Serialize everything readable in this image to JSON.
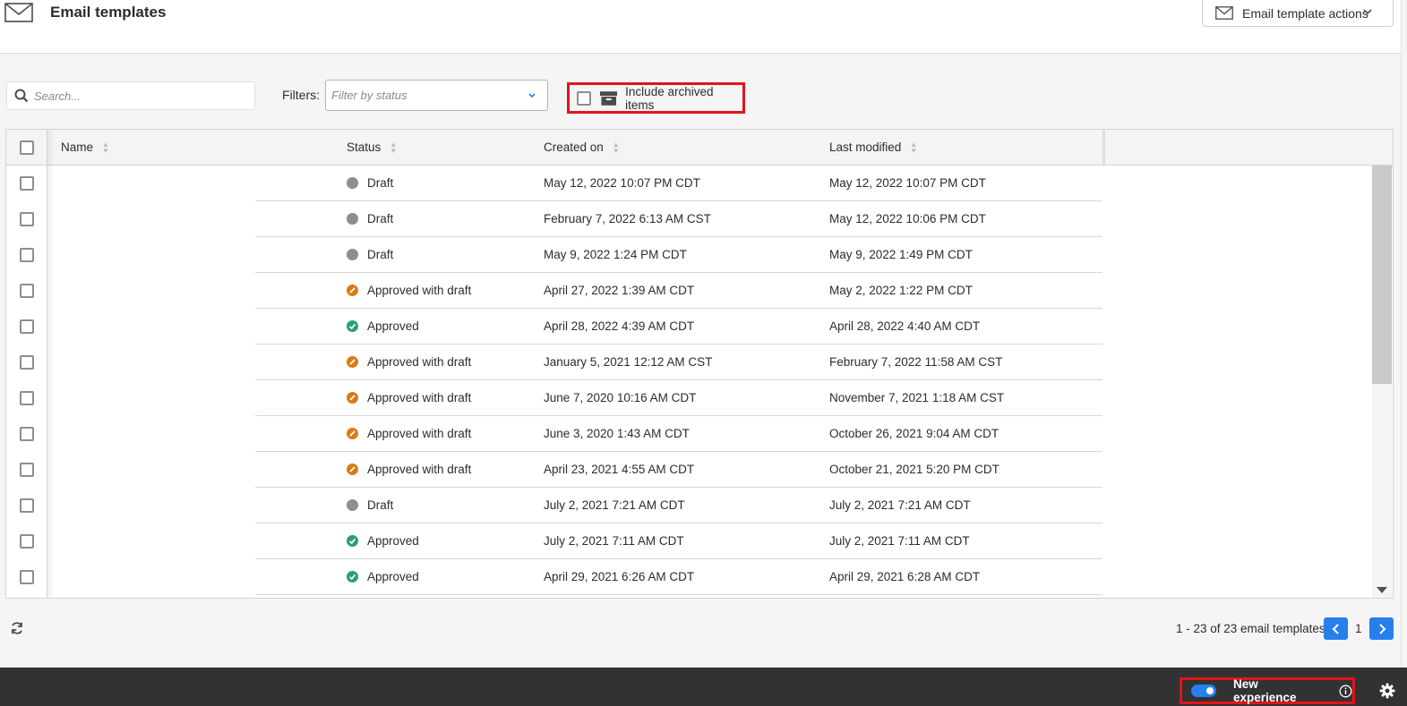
{
  "header": {
    "title": "Email templates",
    "actions_label": "Email template actions"
  },
  "toolbar": {
    "search_placeholder": "Search...",
    "filters_label": "Filters:",
    "filter_placeholder": "Filter by status",
    "include_archived_label": "Include archived items"
  },
  "table": {
    "columns": [
      "Name",
      "Status",
      "Created on",
      "Last modified"
    ],
    "rows": [
      {
        "name": "",
        "status": "Draft",
        "created": "May 12, 2022 10:07 PM CDT",
        "modified": "May 12, 2022 10:07 PM CDT"
      },
      {
        "name": "",
        "status": "Draft",
        "created": "February 7, 2022 6:13 AM CST",
        "modified": "May 12, 2022 10:06 PM CDT"
      },
      {
        "name": "",
        "status": "Draft",
        "created": "May 9, 2022 1:24 PM CDT",
        "modified": "May 9, 2022 1:49 PM CDT"
      },
      {
        "name": "",
        "status": "Approved with draft",
        "created": "April 27, 2022 1:39 AM CDT",
        "modified": "May 2, 2022 1:22 PM CDT"
      },
      {
        "name": "",
        "status": "Approved",
        "created": "April 28, 2022 4:39 AM CDT",
        "modified": "April 28, 2022 4:40 AM CDT"
      },
      {
        "name": "",
        "status": "Approved with draft",
        "created": "January 5, 2021 12:12 AM CST",
        "modified": "February 7, 2022 11:58 AM CST"
      },
      {
        "name": "",
        "status": "Approved with draft",
        "created": "June 7, 2020 10:16 AM CDT",
        "modified": "November 7, 2021 1:18 AM CST"
      },
      {
        "name": "",
        "status": "Approved with draft",
        "created": "June 3, 2020 1:43 AM CDT",
        "modified": "October 26, 2021 9:04 AM CDT"
      },
      {
        "name": "",
        "status": "Approved with draft",
        "created": "April 23, 2021 4:55 AM CDT",
        "modified": "October 21, 2021 5:20 PM CDT"
      },
      {
        "name": "",
        "status": "Draft",
        "created": "July 2, 2021 7:21 AM CDT",
        "modified": "July 2, 2021 7:21 AM CDT"
      },
      {
        "name": "",
        "status": "Approved",
        "created": "July 2, 2021 7:11 AM CDT",
        "modified": "July 2, 2021 7:11 AM CDT"
      },
      {
        "name": "",
        "status": "Approved",
        "created": "April 29, 2021 6:26 AM CDT",
        "modified": "April 29, 2021 6:28 AM CDT"
      }
    ]
  },
  "status_colors": {
    "Draft": "#8e8e8e",
    "Approved with draft": "#da7b11",
    "Approved": "#2d9d78"
  },
  "footer": {
    "pager_text": "1 - 23 of 23 email templates",
    "page": "1",
    "new_experience_label": "New experience"
  },
  "icons": {
    "header": "envelope-icon",
    "search": "search-icon",
    "archive": "archive-box-icon",
    "refresh": "refresh-icon",
    "info": "info-icon",
    "settings": "gear-icon"
  }
}
